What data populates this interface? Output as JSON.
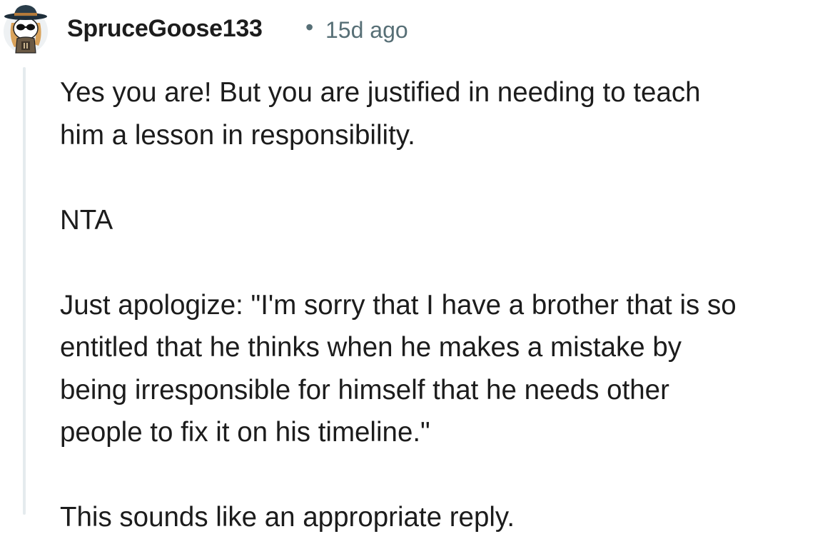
{
  "comment": {
    "author": "SpruceGoose133",
    "separator": "•",
    "timestamp": "15d ago",
    "avatar_icon": "snoo-avatar-cowboy-hat-sunglasses-icon",
    "paragraphs": [
      [
        "Yes you are! But you are justified in needing to teach",
        "him a lesson in responsibility."
      ],
      [
        "NTA"
      ],
      [
        "Just apologize: \"I'm sorry that I have a brother that is so",
        "entitled that he thinks when he makes a mistake by",
        "being irresponsible for himself that he needs other",
        "people to fix it on his timeline.\""
      ],
      [
        "This sounds like an appropriate reply."
      ]
    ]
  },
  "colors": {
    "text": "#1c1c1c",
    "meta": "#576f76",
    "thread_line": "#e5ebee"
  }
}
